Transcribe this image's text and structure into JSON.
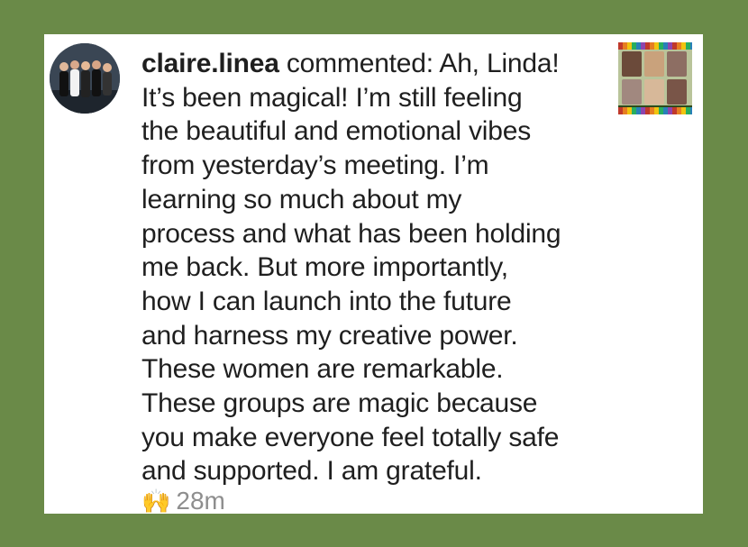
{
  "comment": {
    "username": "claire.linea",
    "lines": [
      " commented: Ah, Linda!",
      "It’s been magical! I’m still feeling",
      "the beautiful and emotional vibes",
      "from yesterday’s meeting. I’m",
      "learning so much about my",
      "process and what has been holding",
      "me back. But more importantly,",
      "how I can launch into the future",
      "and harness my creative power.",
      "These women are remarkable.",
      "These groups are magic because",
      "you make everyone feel totally safe",
      "and supported. I am grateful."
    ],
    "reaction_emoji": "🙌",
    "timestamp": "28m"
  },
  "avatar": {
    "icon": "profile-photo-group"
  },
  "thumbnail": {
    "icon": "post-thumbnail-group-photo",
    "face_colors": [
      "#6b4a3a",
      "#c9a27c",
      "#8d6e63",
      "#a1887f",
      "#d7b899",
      "#795548"
    ]
  },
  "colors": {
    "background": "#6a8a48",
    "card": "#ffffff",
    "text": "#1f1f1f",
    "meta": "#8e8e8e"
  }
}
